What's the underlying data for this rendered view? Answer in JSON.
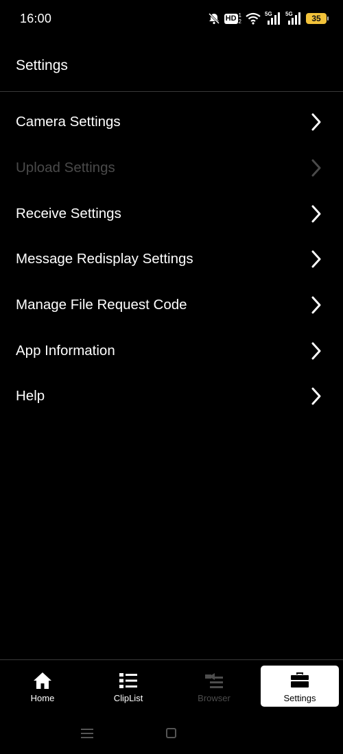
{
  "status_bar": {
    "time": "16:00",
    "hd_label": "HD",
    "signal_1_label": "5G",
    "signal_2_label": "5G",
    "battery_level": "35"
  },
  "header": {
    "title": "Settings"
  },
  "settings_list": [
    {
      "label": "Camera Settings",
      "enabled": true
    },
    {
      "label": "Upload Settings",
      "enabled": false
    },
    {
      "label": "Receive Settings",
      "enabled": true
    },
    {
      "label": "Message Redisplay Settings",
      "enabled": true
    },
    {
      "label": "Manage File Request Code",
      "enabled": true
    },
    {
      "label": "App Information",
      "enabled": true
    },
    {
      "label": "Help",
      "enabled": true
    }
  ],
  "bottom_nav": {
    "tabs": [
      {
        "label": "Home",
        "icon": "home-icon",
        "state": "normal"
      },
      {
        "label": "ClipList",
        "icon": "list-icon",
        "state": "normal"
      },
      {
        "label": "Browser",
        "icon": "browser-icon",
        "state": "disabled"
      },
      {
        "label": "Settings",
        "icon": "toolbox-icon",
        "state": "active"
      }
    ]
  },
  "colors": {
    "background": "#000000",
    "text": "#ffffff",
    "disabled_text": "#4a4a4a",
    "divider": "#3a3a3a",
    "battery": "#f2c23a"
  }
}
